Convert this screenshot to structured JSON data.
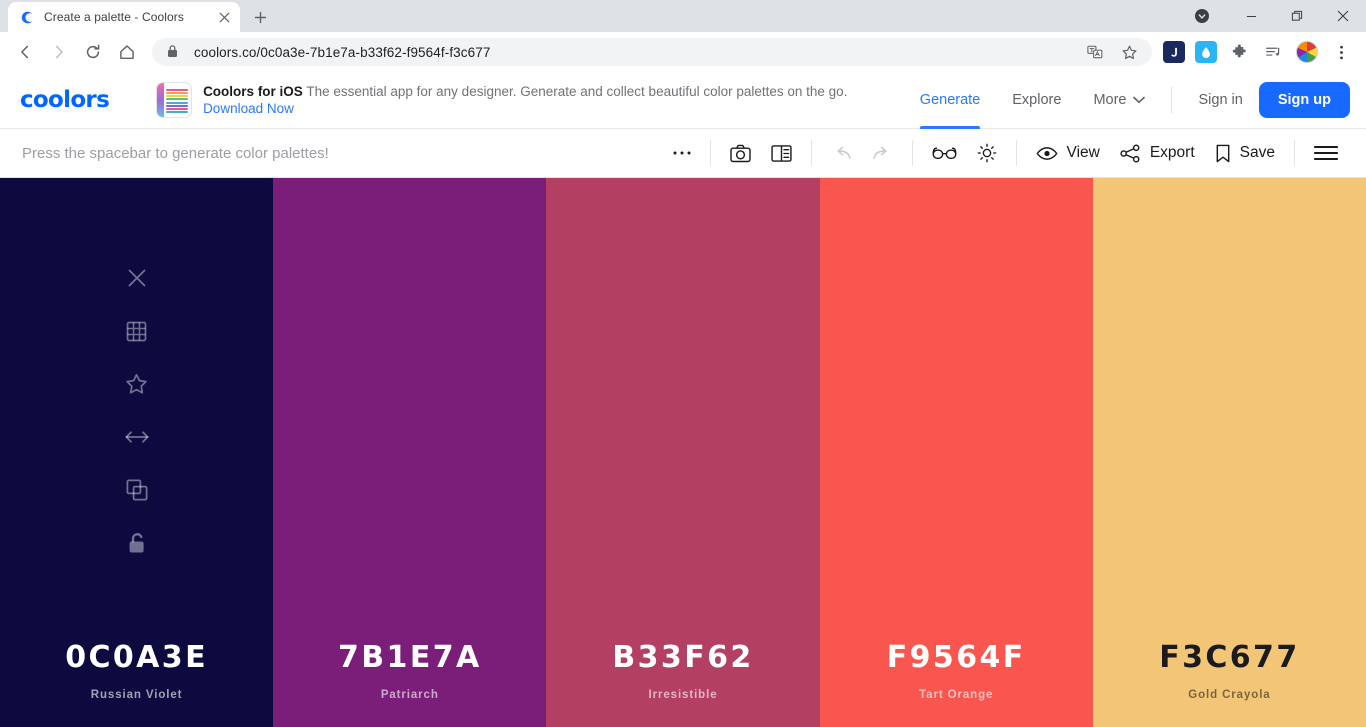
{
  "browser": {
    "tab": {
      "title": "Create a palette - Coolors",
      "favicon": "coolors-c-icon"
    },
    "newtab_label": "+",
    "omnibox": {
      "url": "coolors.co/0c0a3e-7b1e7a-b33f62-f9564f-f3c677",
      "lock_icon": "lock-icon",
      "translate_icon": "translate-icon",
      "bookmark_icon": "star-icon"
    },
    "extensions": [
      {
        "name": "journal-extension",
        "glyph": "J",
        "bg": "#1a2a5e"
      },
      {
        "name": "droplet-extension",
        "glyph": "●",
        "bg": "#29b6f6"
      },
      {
        "name": "puzzle-extension",
        "glyph": "puzzle",
        "bg": "transparent"
      },
      {
        "name": "playlist-extension",
        "glyph": "playlist",
        "bg": "transparent"
      }
    ],
    "profile_avatar": "profile-avatar",
    "menu_icon": "three-dot-menu-icon",
    "window_controls": {
      "tab_search": "tab-search-icon",
      "minimize": "minimize-icon",
      "maximize": "maximize-icon",
      "close": "close-icon"
    }
  },
  "header": {
    "logo": "coolors",
    "promo": {
      "title": "Coolors for iOS",
      "description": "The essential app for any designer. Generate and collect beautiful color palettes on the go.",
      "link": "Download Now"
    },
    "nav": [
      {
        "label": "Generate",
        "active": true
      },
      {
        "label": "Explore",
        "active": false
      },
      {
        "label": "More",
        "active": false,
        "caret": true
      }
    ],
    "sign_in": "Sign in",
    "sign_up": "Sign up"
  },
  "toolbar": {
    "hint": "Press the spacebar to generate color palettes!",
    "more_icon": "ellipsis-icon",
    "camera_icon": "camera-icon",
    "layout_icon": "layout-panel-icon",
    "undo_icon": "undo-icon",
    "redo_icon": "redo-icon",
    "glasses_icon": "glasses-icon",
    "adjust_icon": "brightness-icon",
    "view_icon": "eye-icon",
    "view_label": "View",
    "export_icon": "share-icon",
    "export_label": "Export",
    "save_icon": "bookmark-icon",
    "save_label": "Save",
    "menu_icon": "hamburger-menu-icon"
  },
  "swatch_tools": [
    {
      "name": "remove-color-icon"
    },
    {
      "name": "view-shades-icon"
    },
    {
      "name": "favorite-icon"
    },
    {
      "name": "drag-handle-icon"
    },
    {
      "name": "copy-hex-icon"
    },
    {
      "name": "lock-toggle-icon"
    }
  ],
  "palette": [
    {
      "hex": "0C0A3E",
      "color": "#0c0a3e",
      "name": "Russian Violet",
      "text": "#ffffff",
      "icon_color": "rgba(255,255,255,0.42)"
    },
    {
      "hex": "7B1E7A",
      "color": "#7b1e7a",
      "name": "Patriarch",
      "text": "#ffffff",
      "icon_color": "rgba(255,255,255,0.42)"
    },
    {
      "hex": "B33F62",
      "color": "#b33f62",
      "name": "Irresistible",
      "text": "#ffffff",
      "icon_color": "rgba(255,255,255,0.42)"
    },
    {
      "hex": "F9564F",
      "color": "#f9564f",
      "name": "Tart Orange",
      "text": "#ffffff",
      "icon_color": "rgba(255,255,255,0.42)"
    },
    {
      "hex": "F3C677",
      "color": "#f3c677",
      "name": "Gold Crayola",
      "text": "#1b1b1f",
      "icon_color": "rgba(0,0,0,0.42)"
    }
  ]
}
